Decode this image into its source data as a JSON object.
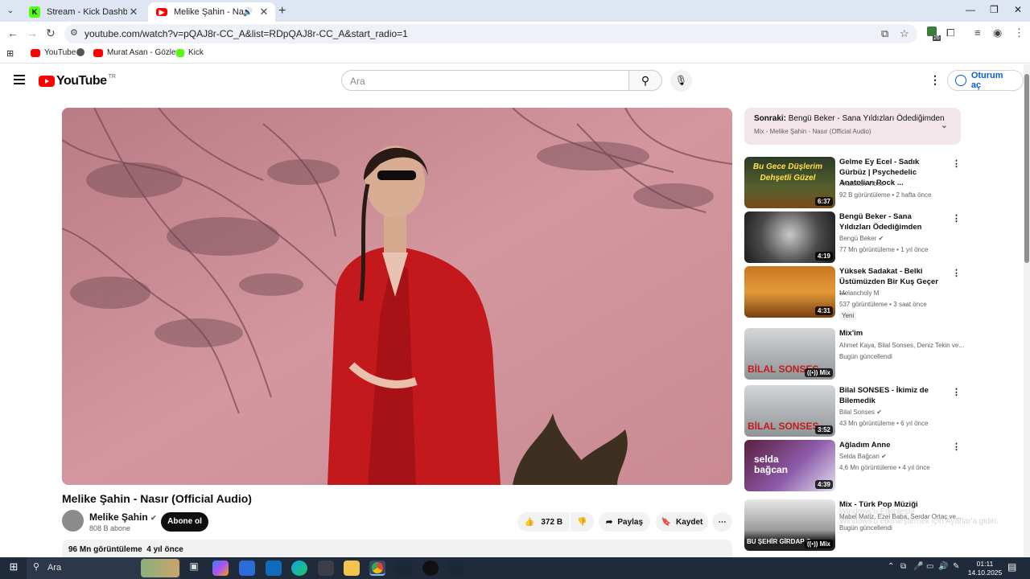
{
  "browser": {
    "tabs": [
      {
        "title": "Stream - Kick Dashboard",
        "icon": "kick-icon"
      },
      {
        "title": "Melike Şahin - Nasır (Official",
        "icon": "youtube-icon"
      }
    ],
    "url": "youtube.com/watch?v=pQAJ8r-CC_A&list=RDpQAJ8r-CC_A&start_radio=1",
    "extension_badge": "26",
    "bookmarks": [
      {
        "label": "YouTube",
        "icon": "youtube-icon"
      },
      {
        "label": "",
        "icon": "globe-icon"
      },
      {
        "label": "Murat Asan - Gözler...",
        "icon": "youtube-icon"
      },
      {
        "label": "Kick",
        "icon": "kick-icon"
      }
    ]
  },
  "header": {
    "logo": "YouTube",
    "country": "TR",
    "search_placeholder": "Ara",
    "signin": "Oturum aç"
  },
  "video": {
    "title": "Melike Şahin - Nasır (Official Audio)",
    "channel": "Melike Şahin",
    "subscribers": "808 B abone",
    "subscribe": "Abone ol",
    "likes": "372 B",
    "share": "Paylaş",
    "save": "Kaydet",
    "views": "96 Mn görüntüleme",
    "age": "4 yıl önce"
  },
  "up_next": {
    "label": "Sonraki:",
    "title": "Bengü Beker - Sana Yıldızları Ödediğimden",
    "sub": "Mix - Melike Şahin - Nasır (Official Audio)"
  },
  "recommendations": [
    {
      "title": "Gelme Ey Ecel - Sadık Gürbüz | Psychedelic Anatolian Rock ...",
      "channel": "Anatolian Vibes",
      "meta": "92 B görüntüleme • 2 hafta önce",
      "duration": "6:37",
      "thumb_text": "Bu Gece Düşlerim Dehşetli Güzel",
      "verified": false,
      "badge": ""
    },
    {
      "title": "Bengü Beker - Sana Yıldızları Ödediğimden",
      "channel": "Bengü Beker",
      "meta": "77 Mn görüntüleme • 1 yıl önce",
      "duration": "4:19",
      "thumb_text": "",
      "verified": true,
      "badge": ""
    },
    {
      "title": "Yüksek Sadakat - Belki Üstümüzden Bir Kuş Geçer ...",
      "channel": "Melancholy M",
      "meta": "537 görüntüleme • 3 saat önce",
      "duration": "4:31",
      "thumb_text": "",
      "verified": false,
      "badge": "Yeni"
    },
    {
      "title": "Mix'im",
      "channel": "Ahmet Kaya, Bilal Sonses, Deniz Tekin ve...",
      "meta": "Bugün güncellendi",
      "duration": "Mix",
      "thumb_text": "BİLAL SONSES",
      "verified": false,
      "badge": ""
    },
    {
      "title": "Bilal SONSES - İkimiz de Bilemedik",
      "channel": "Bilal Sonses",
      "meta": "43 Mn görüntüleme • 6 yıl önce",
      "duration": "3:52",
      "thumb_text": "BİLAL SONSES",
      "verified": true,
      "badge": ""
    },
    {
      "title": "Ağladım Anne",
      "channel": "Selda Bağcan",
      "meta": "4,6 Mn görüntüleme • 4 yıl önce",
      "duration": "4:39",
      "thumb_text": "selda bağcan",
      "verified": true,
      "badge": ""
    },
    {
      "title": "Mix - Türk Pop Müziği",
      "channel": "Mabel Matiz, Ezel Baba, Serdar Ortaç ve...",
      "meta": "Bugün güncellendi",
      "duration": "Mix",
      "thumb_text": "BU ŞEHİR GİRDAP G",
      "verified": false,
      "badge": ""
    }
  ],
  "watermark": {
    "line1": "Windows'u Etkinleştir",
    "line2": "Windows'u etkinleştirmek için Ayarlar'a gidin."
  },
  "taskbar": {
    "search": "Ara",
    "time": "01:11",
    "date": "14.10.2025"
  }
}
